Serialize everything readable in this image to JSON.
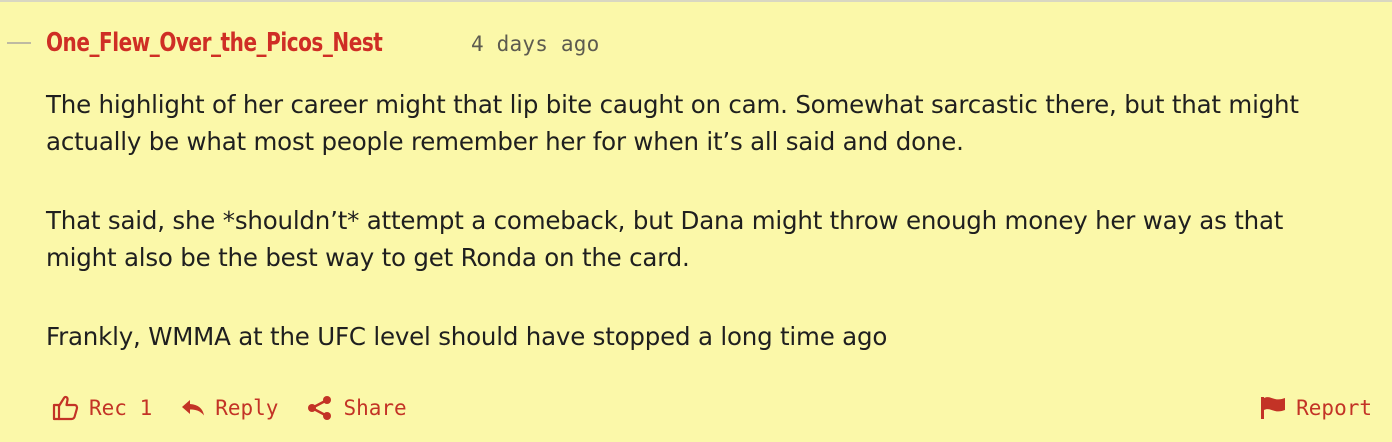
{
  "comment": {
    "author": "One_Flew_Over_the_Picos_Nest",
    "timestamp": "4 days ago",
    "paragraphs": [
      "The highlight of her career might that lip bite caught on cam. Somewhat sarcastic there, but that might actually be what most people remember her for when it’s all said and done.",
      "That said, she *shouldn’t* attempt a comeback, but Dana might throw enough money her way as that might also be the best way to get Ronda on the card.",
      "Frankly, WMMA at the UFC level should have stopped a long time ago"
    ]
  },
  "actions": {
    "rec_label": "Rec 1",
    "reply_label": "Reply",
    "share_label": "Share",
    "report_label": "Report"
  },
  "colors": {
    "background": "#fbf8a9",
    "accent": "#cf2e25",
    "text": "#1f1f1f",
    "muted": "#5d5b4f"
  },
  "icons": {
    "rec": "thumbs-up-icon",
    "reply": "reply-arrow-icon",
    "share": "share-icon",
    "report": "flag-icon"
  }
}
